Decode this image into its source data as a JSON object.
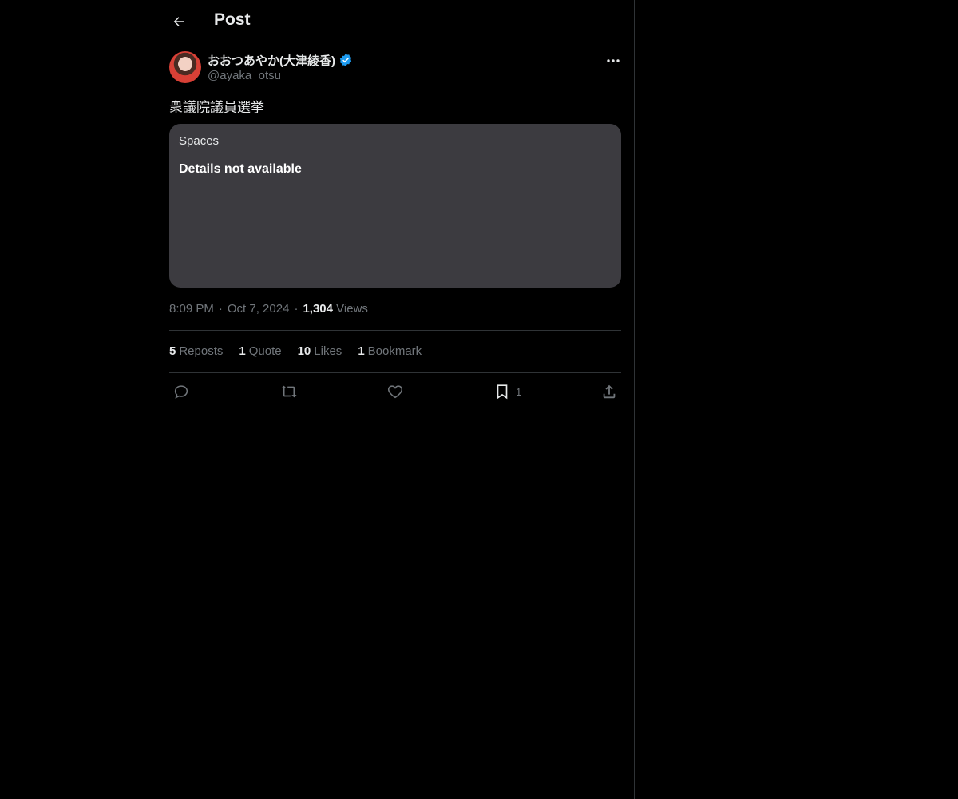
{
  "header": {
    "title": "Post"
  },
  "author": {
    "display_name": "おおつあやか(大津綾香)",
    "handle": "@ayaka_otsu",
    "verified": true
  },
  "post": {
    "text": "衆議院議員選挙",
    "card": {
      "label": "Spaces",
      "detail": "Details not available"
    },
    "time": "8:09 PM",
    "date": "Oct 7, 2024",
    "views_count": "1,304",
    "views_label": "Views"
  },
  "stats": {
    "reposts_count": "5",
    "reposts_label": "Reposts",
    "quotes_count": "1",
    "quotes_label": "Quote",
    "likes_count": "10",
    "likes_label": "Likes",
    "bookmarks_count": "1",
    "bookmarks_label": "Bookmark"
  },
  "actions": {
    "bookmark_count": "1"
  },
  "colors": {
    "background": "#000000",
    "text": "#e7e9ea",
    "muted": "#71767b",
    "card": "#3c3b40",
    "verified": "#1d9bf0",
    "border": "#2f3336"
  },
  "icons": {
    "back": "arrow-left-icon",
    "more": "more-horizontal-icon",
    "verified": "verified-badge-icon",
    "reply": "reply-icon",
    "repost": "repost-icon",
    "like": "heart-icon",
    "bookmark": "bookmark-icon",
    "share": "share-icon"
  }
}
